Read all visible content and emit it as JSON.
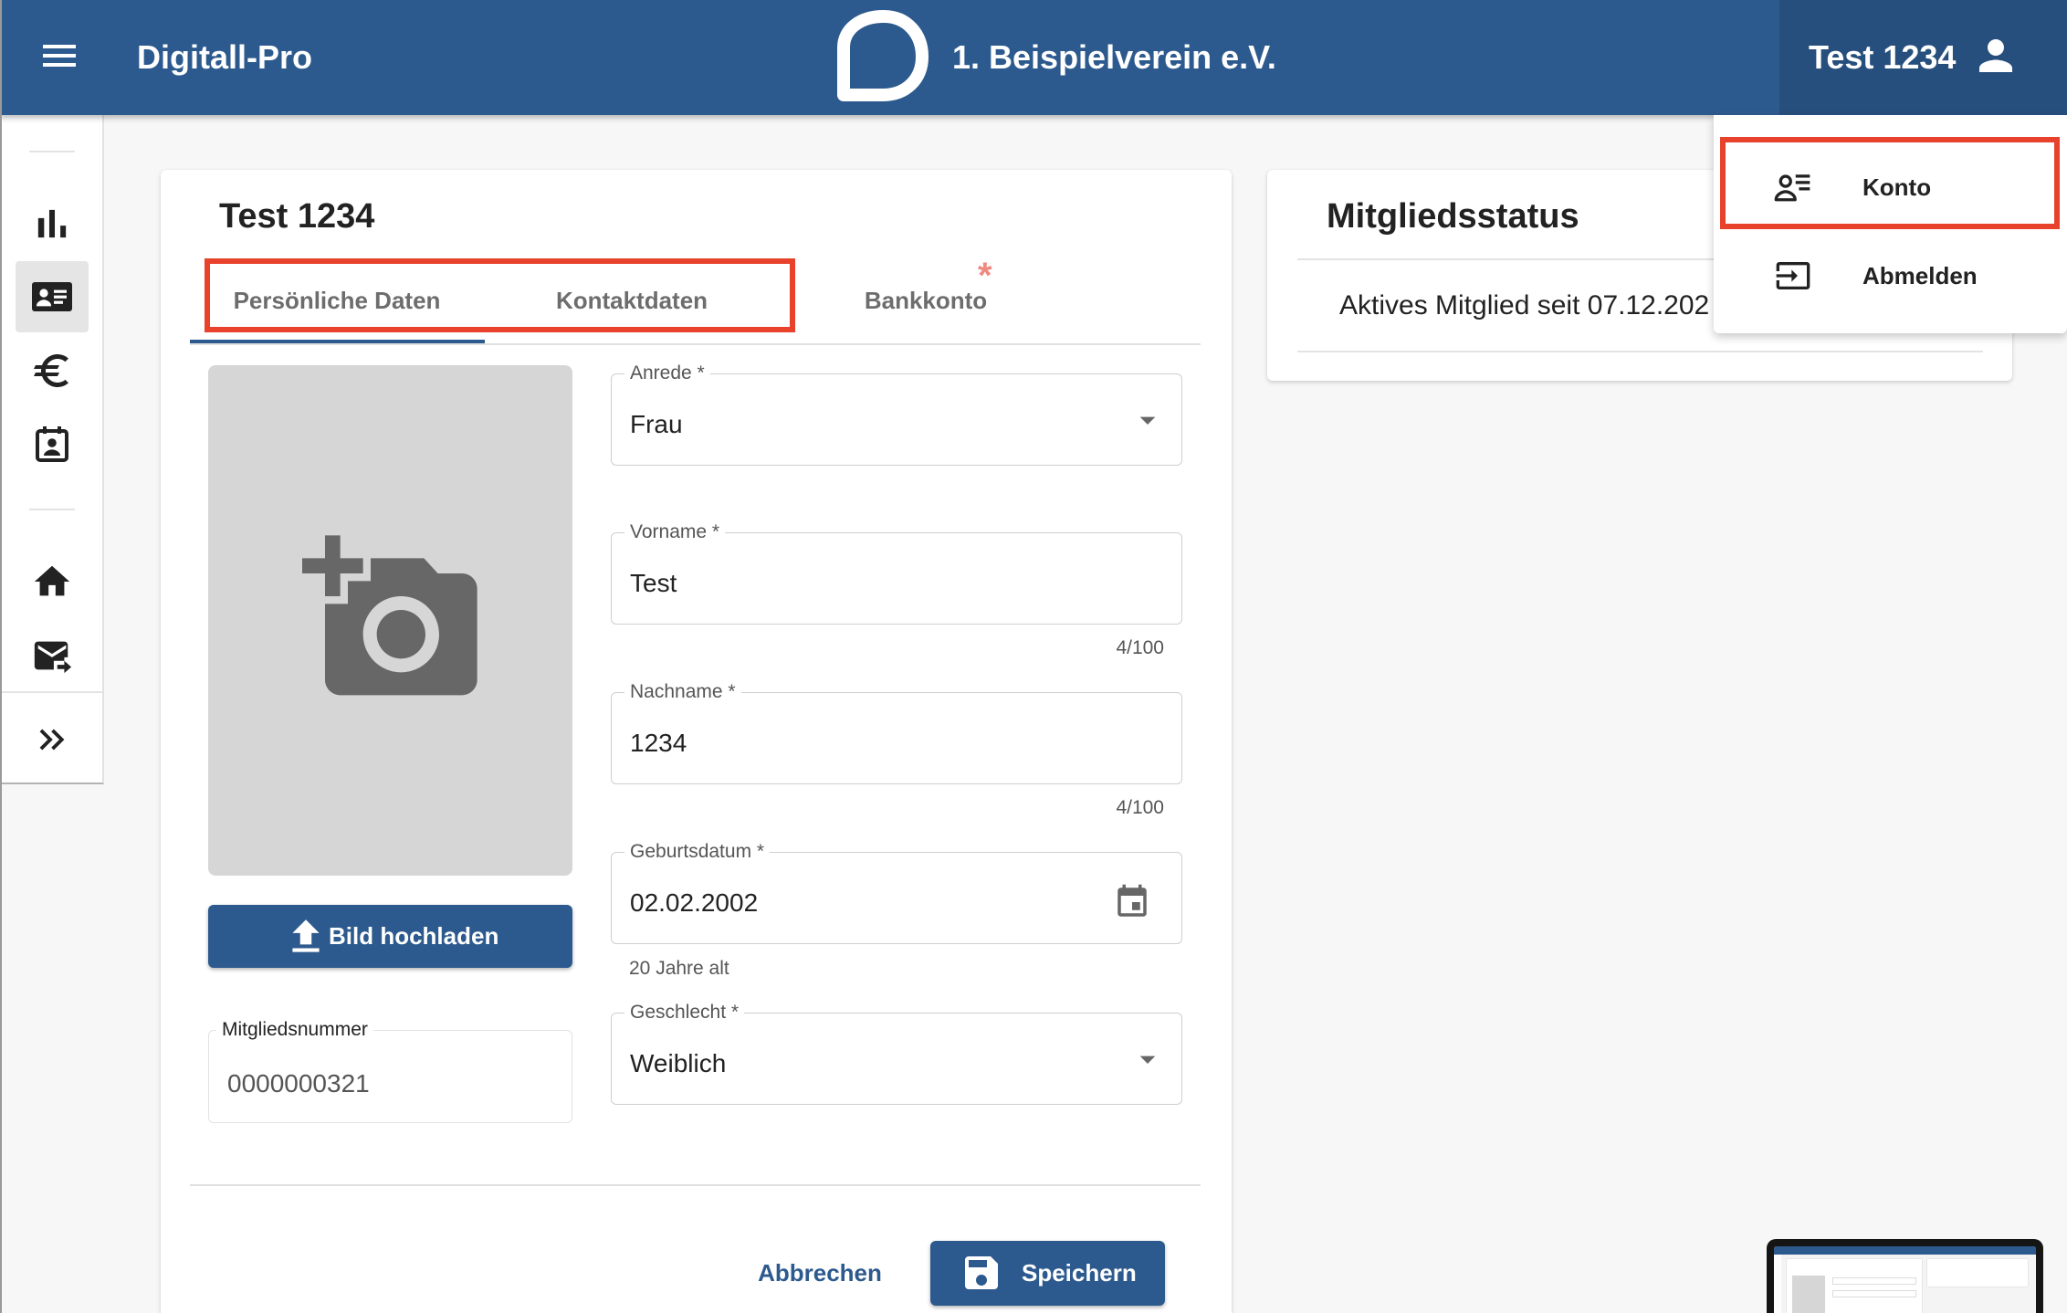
{
  "app": {
    "title": "Digitall-Pro",
    "club_name": "1. Beispielverein e.V."
  },
  "colors": {
    "primary": "#2d5a8e",
    "header_user_area": "#274f7d",
    "annotation": "#e8412c",
    "required_marker": "#ef8a80",
    "page_background": "#f7f7f7"
  },
  "header": {
    "menu_icon": "menu-icon",
    "logo_icon": "club-logo",
    "user_name": "Test 1234",
    "user_icon": "person-icon"
  },
  "user_menu": {
    "items": [
      {
        "label": "Konto",
        "icon": "account-details-icon"
      },
      {
        "label": "Abmelden",
        "icon": "login-icon"
      }
    ]
  },
  "sidebar": {
    "items": [
      {
        "icon": "bar-chart-icon"
      },
      {
        "icon": "contact-card-icon",
        "active": true
      },
      {
        "icon": "euro-icon"
      },
      {
        "icon": "contact-calendar-icon"
      },
      {
        "icon": "home-icon"
      },
      {
        "icon": "forward-to-inbox-icon"
      },
      {
        "icon": "double-chevron-right-icon"
      }
    ]
  },
  "member_card": {
    "title": "Test 1234",
    "tabs": [
      {
        "label": "Persönliche Daten",
        "active": true
      },
      {
        "label": "Kontaktdaten"
      },
      {
        "label": "Bankkonto",
        "required_marker": "*"
      }
    ],
    "photo_icon": "add-photo-icon",
    "upload_button": {
      "label": "Bild hochladen",
      "icon": "upload-icon"
    },
    "member_number": {
      "label": "Mitgliedsnummer",
      "value": "0000000321"
    },
    "fields": {
      "salutation": {
        "label": "Anrede *",
        "value": "Frau"
      },
      "first_name": {
        "label": "Vorname *",
        "value": "Test",
        "counter": "4/100"
      },
      "last_name": {
        "label": "Nachname *",
        "value": "1234",
        "counter": "4/100"
      },
      "birth_date": {
        "label": "Geburtsdatum *",
        "value": "02.02.2002",
        "hint": "20 Jahre alt"
      },
      "gender": {
        "label": "Geschlecht *",
        "value": "Weiblich"
      }
    },
    "actions": {
      "cancel": "Abbrechen",
      "save": "Speichern",
      "save_icon": "save-icon"
    }
  },
  "status_card": {
    "title": "Mitgliedsstatus",
    "text": "Aktives Mitglied seit 07.12.202"
  }
}
